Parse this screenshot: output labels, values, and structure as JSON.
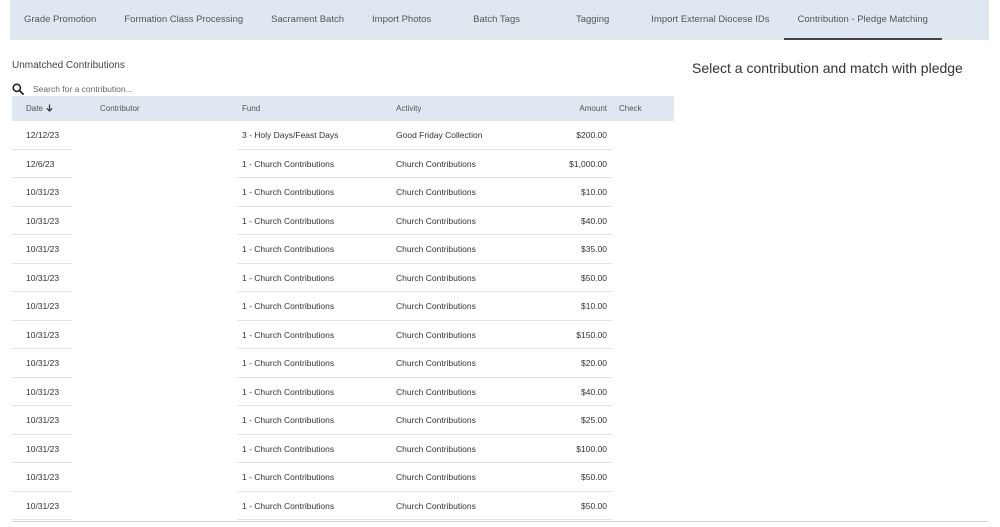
{
  "tabs": [
    {
      "label": "Grade Promotion",
      "active": false
    },
    {
      "label": "Formation Class Processing",
      "active": false
    },
    {
      "label": "Sacrament Batch",
      "active": false
    },
    {
      "label": "Import Photos",
      "active": false
    },
    {
      "label": "Batch Tags",
      "active": false
    },
    {
      "label": "Tagging",
      "active": false
    },
    {
      "label": "Import External Diocese IDs",
      "active": false
    },
    {
      "label": "Contribution - Pledge Matching",
      "active": true
    }
  ],
  "unmatched": {
    "title": "Unmatched Contributions",
    "search_placeholder": "Search for a contribution..."
  },
  "table": {
    "headers": {
      "date": "Date",
      "contributor": "Contributor",
      "fund": "Fund",
      "activity": "Activity",
      "amount": "Amount",
      "check": "Check"
    },
    "rows": [
      {
        "date": "12/12/23",
        "contributor": "",
        "fund": "3 - Holy Days/Feast Days",
        "activity": "Good Friday Collection",
        "amount": "$200.00",
        "check": ""
      },
      {
        "date": "12/6/23",
        "contributor": "",
        "fund": "1 - Church Contributions",
        "activity": "Church Contributions",
        "amount": "$1,000.00",
        "check": ""
      },
      {
        "date": "10/31/23",
        "contributor": "",
        "fund": "1 - Church Contributions",
        "activity": "Church Contributions",
        "amount": "$10.00",
        "check": ""
      },
      {
        "date": "10/31/23",
        "contributor": "",
        "fund": "1 - Church Contributions",
        "activity": "Church Contributions",
        "amount": "$40.00",
        "check": ""
      },
      {
        "date": "10/31/23",
        "contributor": "",
        "fund": "1 - Church Contributions",
        "activity": "Church Contributions",
        "amount": "$35.00",
        "check": ""
      },
      {
        "date": "10/31/23",
        "contributor": "",
        "fund": "1 - Church Contributions",
        "activity": "Church Contributions",
        "amount": "$50.00",
        "check": ""
      },
      {
        "date": "10/31/23",
        "contributor": "",
        "fund": "1 - Church Contributions",
        "activity": "Church Contributions",
        "amount": "$10.00",
        "check": ""
      },
      {
        "date": "10/31/23",
        "contributor": "",
        "fund": "1 - Church Contributions",
        "activity": "Church Contributions",
        "amount": "$150.00",
        "check": ""
      },
      {
        "date": "10/31/23",
        "contributor": "",
        "fund": "1 - Church Contributions",
        "activity": "Church Contributions",
        "amount": "$20.00",
        "check": ""
      },
      {
        "date": "10/31/23",
        "contributor": "",
        "fund": "1 - Church Contributions",
        "activity": "Church Contributions",
        "amount": "$40.00",
        "check": ""
      },
      {
        "date": "10/31/23",
        "contributor": "",
        "fund": "1 - Church Contributions",
        "activity": "Church Contributions",
        "amount": "$25.00",
        "check": ""
      },
      {
        "date": "10/31/23",
        "contributor": "",
        "fund": "1 - Church Contributions",
        "activity": "Church Contributions",
        "amount": "$100.00",
        "check": ""
      },
      {
        "date": "10/31/23",
        "contributor": "",
        "fund": "1 - Church Contributions",
        "activity": "Church Contributions",
        "amount": "$50.00",
        "check": ""
      },
      {
        "date": "10/31/23",
        "contributor": "",
        "fund": "1 - Church Contributions",
        "activity": "Church Contributions",
        "amount": "$50.00",
        "check": ""
      }
    ]
  },
  "pledge_panel": {
    "message": "Select a contribution and match with pledge"
  },
  "icons": {
    "search": "search-icon",
    "sort": "arrow-down-icon"
  }
}
